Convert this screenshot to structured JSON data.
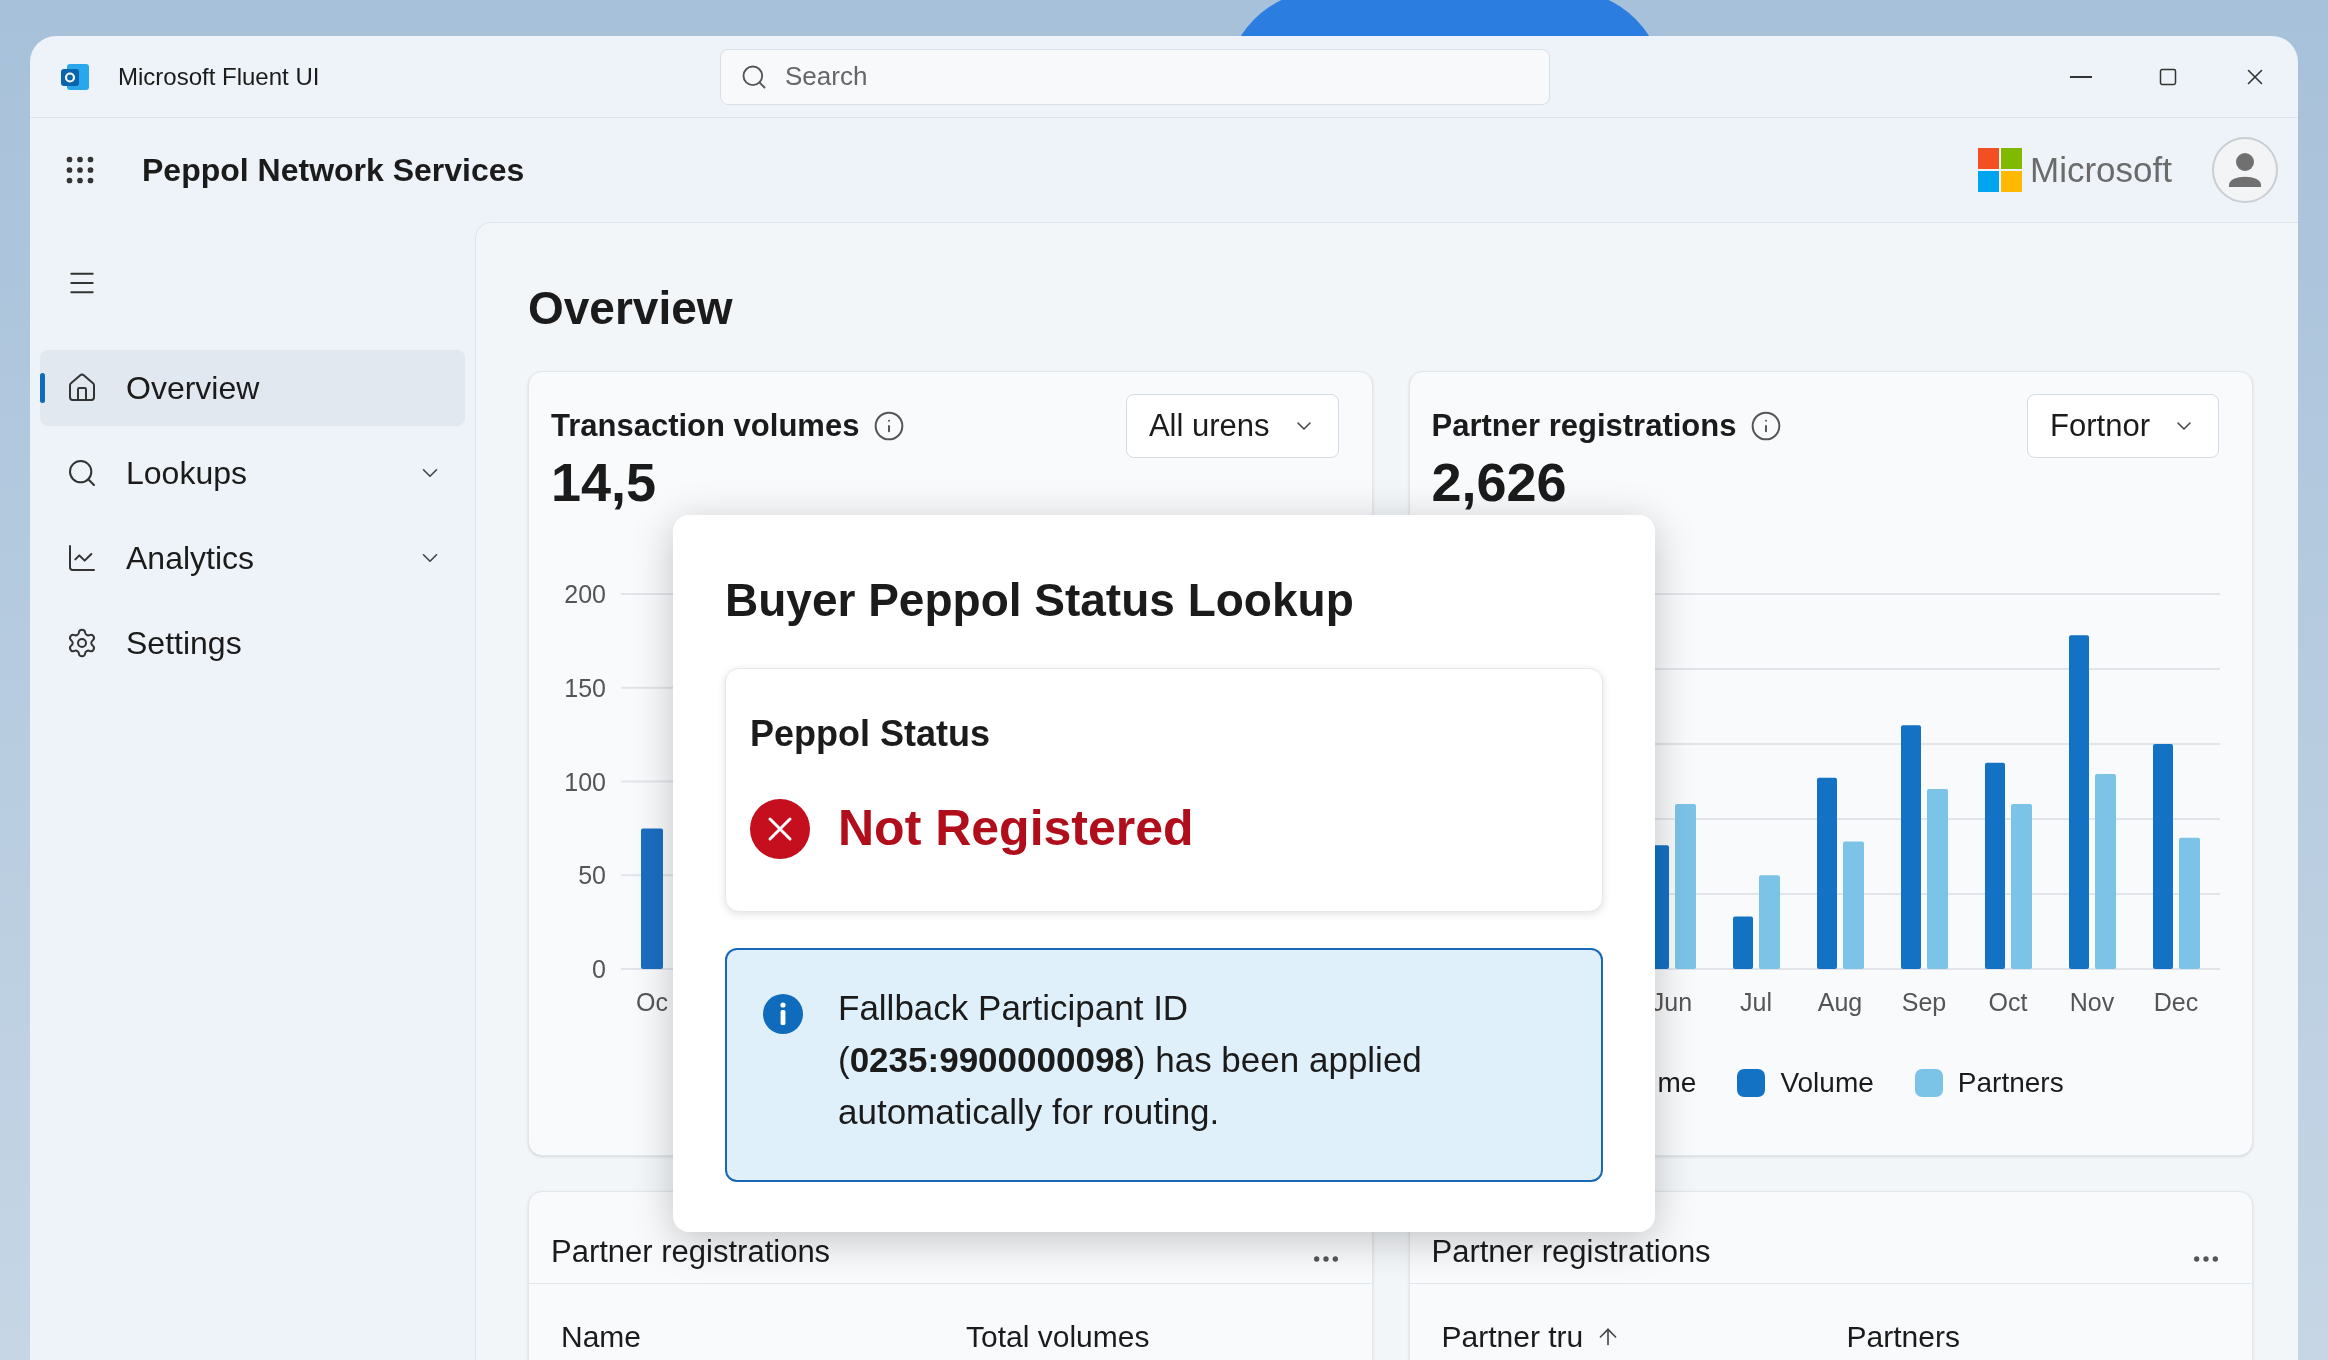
{
  "window": {
    "title": "Microsoft Fluent UI"
  },
  "search": {
    "placeholder": "Search"
  },
  "header": {
    "app_name": "Peppol Network Services",
    "brand": "Microsoft"
  },
  "sidebar": {
    "items": [
      {
        "label": "Overview",
        "selected": true
      },
      {
        "label": "Lookups",
        "selected": false,
        "expanded": false
      },
      {
        "label": "Analytics",
        "selected": false,
        "expanded": false
      },
      {
        "label": "Settings",
        "selected": false
      }
    ]
  },
  "page": {
    "title": "Overview"
  },
  "cards": [
    {
      "title": "Transaction volumes",
      "filter": "All urens",
      "total": "14,5",
      "chart_data": {
        "type": "bar",
        "grid": true,
        "categories": [
          "Oc"
        ],
        "yticks": [
          0,
          50,
          100,
          150,
          200
        ],
        "ylim": [
          0,
          200
        ],
        "series": [
          {
            "color": "#1b6ec2",
            "values": [
              75
            ]
          }
        ]
      }
    },
    {
      "title": "Partner registrations",
      "filter": "Fortnor",
      "total": "2,626",
      "months": [
        "Jun",
        "Jul",
        "Aug",
        "Sep",
        "Oct",
        "Nov",
        "Dec"
      ],
      "legend": [
        {
          "label": "me"
        },
        {
          "label": "Volume",
          "color": "#1472c4"
        },
        {
          "label": "Partners",
          "color": "#7cc3e8"
        }
      ]
    }
  ],
  "tables": [
    {
      "title": "Partner registrations",
      "columns": [
        {
          "label": "Name",
          "sorted": false
        },
        {
          "label": "Total volumes",
          "sorted": false
        }
      ]
    },
    {
      "title": "Partner registrations",
      "columns": [
        {
          "label": "Partner tru",
          "sorted": true
        },
        {
          "label": "Partners",
          "sorted": false
        }
      ]
    }
  ],
  "dialog": {
    "title": "Buyer Peppol Status Lookup",
    "status_label": "Peppol Status",
    "status": {
      "kind": "error",
      "text": "Not Registered"
    },
    "message": "Fallback Participant ID (**0235:9900000098**) has been applied automatically for routing."
  }
}
